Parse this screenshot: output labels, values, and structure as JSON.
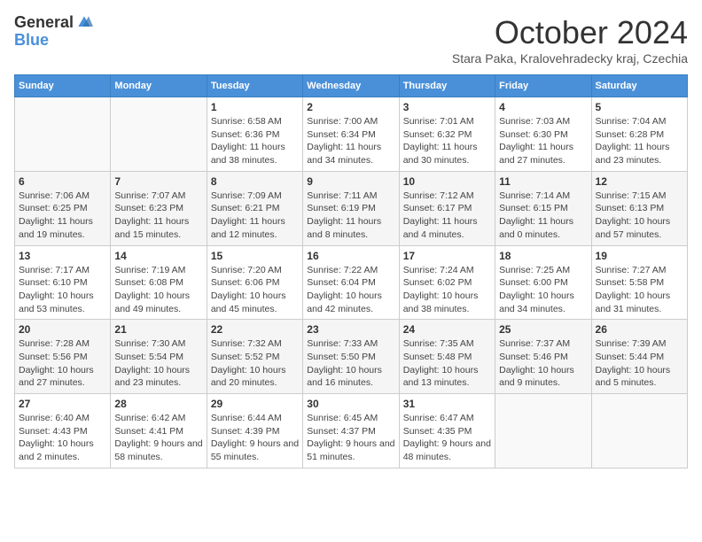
{
  "logo": {
    "general": "General",
    "blue": "Blue"
  },
  "title": "October 2024",
  "location": "Stara Paka, Kralovehradecky kraj, Czechia",
  "weekdays": [
    "Sunday",
    "Monday",
    "Tuesday",
    "Wednesday",
    "Thursday",
    "Friday",
    "Saturday"
  ],
  "weeks": [
    [
      {
        "day": "",
        "info": ""
      },
      {
        "day": "",
        "info": ""
      },
      {
        "day": "1",
        "info": "Sunrise: 6:58 AM\nSunset: 6:36 PM\nDaylight: 11 hours and 38 minutes."
      },
      {
        "day": "2",
        "info": "Sunrise: 7:00 AM\nSunset: 6:34 PM\nDaylight: 11 hours and 34 minutes."
      },
      {
        "day": "3",
        "info": "Sunrise: 7:01 AM\nSunset: 6:32 PM\nDaylight: 11 hours and 30 minutes."
      },
      {
        "day": "4",
        "info": "Sunrise: 7:03 AM\nSunset: 6:30 PM\nDaylight: 11 hours and 27 minutes."
      },
      {
        "day": "5",
        "info": "Sunrise: 7:04 AM\nSunset: 6:28 PM\nDaylight: 11 hours and 23 minutes."
      }
    ],
    [
      {
        "day": "6",
        "info": "Sunrise: 7:06 AM\nSunset: 6:25 PM\nDaylight: 11 hours and 19 minutes."
      },
      {
        "day": "7",
        "info": "Sunrise: 7:07 AM\nSunset: 6:23 PM\nDaylight: 11 hours and 15 minutes."
      },
      {
        "day": "8",
        "info": "Sunrise: 7:09 AM\nSunset: 6:21 PM\nDaylight: 11 hours and 12 minutes."
      },
      {
        "day": "9",
        "info": "Sunrise: 7:11 AM\nSunset: 6:19 PM\nDaylight: 11 hours and 8 minutes."
      },
      {
        "day": "10",
        "info": "Sunrise: 7:12 AM\nSunset: 6:17 PM\nDaylight: 11 hours and 4 minutes."
      },
      {
        "day": "11",
        "info": "Sunrise: 7:14 AM\nSunset: 6:15 PM\nDaylight: 11 hours and 0 minutes."
      },
      {
        "day": "12",
        "info": "Sunrise: 7:15 AM\nSunset: 6:13 PM\nDaylight: 10 hours and 57 minutes."
      }
    ],
    [
      {
        "day": "13",
        "info": "Sunrise: 7:17 AM\nSunset: 6:10 PM\nDaylight: 10 hours and 53 minutes."
      },
      {
        "day": "14",
        "info": "Sunrise: 7:19 AM\nSunset: 6:08 PM\nDaylight: 10 hours and 49 minutes."
      },
      {
        "day": "15",
        "info": "Sunrise: 7:20 AM\nSunset: 6:06 PM\nDaylight: 10 hours and 45 minutes."
      },
      {
        "day": "16",
        "info": "Sunrise: 7:22 AM\nSunset: 6:04 PM\nDaylight: 10 hours and 42 minutes."
      },
      {
        "day": "17",
        "info": "Sunrise: 7:24 AM\nSunset: 6:02 PM\nDaylight: 10 hours and 38 minutes."
      },
      {
        "day": "18",
        "info": "Sunrise: 7:25 AM\nSunset: 6:00 PM\nDaylight: 10 hours and 34 minutes."
      },
      {
        "day": "19",
        "info": "Sunrise: 7:27 AM\nSunset: 5:58 PM\nDaylight: 10 hours and 31 minutes."
      }
    ],
    [
      {
        "day": "20",
        "info": "Sunrise: 7:28 AM\nSunset: 5:56 PM\nDaylight: 10 hours and 27 minutes."
      },
      {
        "day": "21",
        "info": "Sunrise: 7:30 AM\nSunset: 5:54 PM\nDaylight: 10 hours and 23 minutes."
      },
      {
        "day": "22",
        "info": "Sunrise: 7:32 AM\nSunset: 5:52 PM\nDaylight: 10 hours and 20 minutes."
      },
      {
        "day": "23",
        "info": "Sunrise: 7:33 AM\nSunset: 5:50 PM\nDaylight: 10 hours and 16 minutes."
      },
      {
        "day": "24",
        "info": "Sunrise: 7:35 AM\nSunset: 5:48 PM\nDaylight: 10 hours and 13 minutes."
      },
      {
        "day": "25",
        "info": "Sunrise: 7:37 AM\nSunset: 5:46 PM\nDaylight: 10 hours and 9 minutes."
      },
      {
        "day": "26",
        "info": "Sunrise: 7:39 AM\nSunset: 5:44 PM\nDaylight: 10 hours and 5 minutes."
      }
    ],
    [
      {
        "day": "27",
        "info": "Sunrise: 6:40 AM\nSunset: 4:43 PM\nDaylight: 10 hours and 2 minutes."
      },
      {
        "day": "28",
        "info": "Sunrise: 6:42 AM\nSunset: 4:41 PM\nDaylight: 9 hours and 58 minutes."
      },
      {
        "day": "29",
        "info": "Sunrise: 6:44 AM\nSunset: 4:39 PM\nDaylight: 9 hours and 55 minutes."
      },
      {
        "day": "30",
        "info": "Sunrise: 6:45 AM\nSunset: 4:37 PM\nDaylight: 9 hours and 51 minutes."
      },
      {
        "day": "31",
        "info": "Sunrise: 6:47 AM\nSunset: 4:35 PM\nDaylight: 9 hours and 48 minutes."
      },
      {
        "day": "",
        "info": ""
      },
      {
        "day": "",
        "info": ""
      }
    ]
  ]
}
